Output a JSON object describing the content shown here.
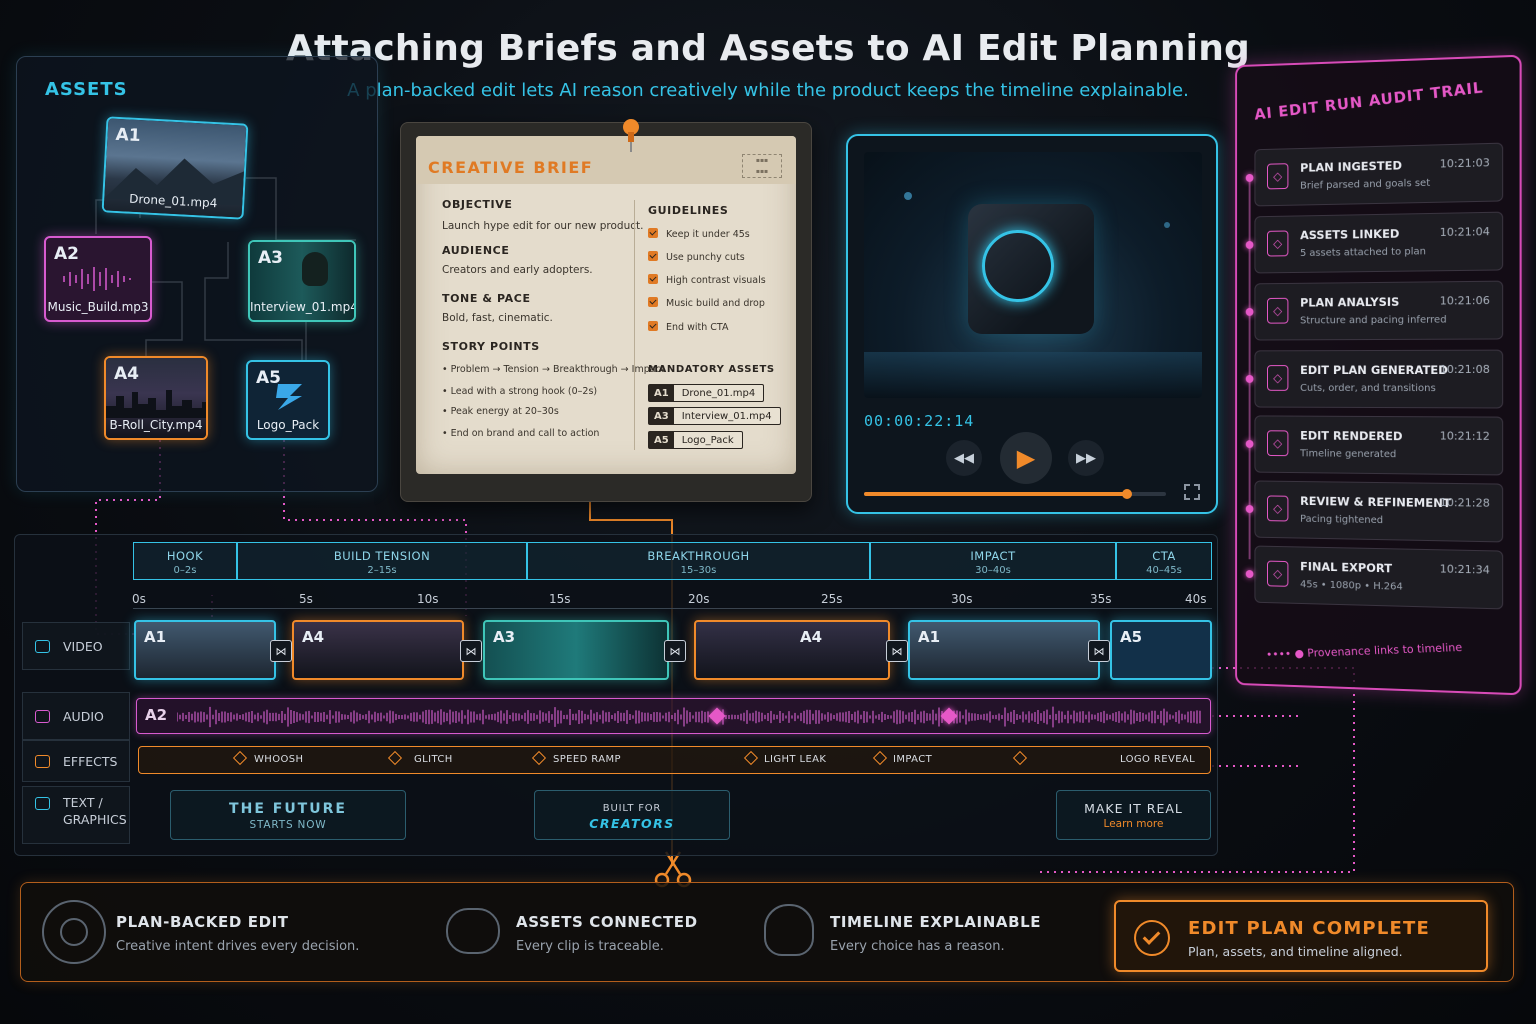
{
  "header": {
    "title": "Attaching Briefs and Assets to AI Edit Planning",
    "subtitle": "A plan-backed edit lets AI reason creatively while the product keeps the timeline explainable."
  },
  "assets": {
    "title": "ASSETS",
    "items": [
      {
        "tag": "A1",
        "name": "Drone_01.mp4"
      },
      {
        "tag": "A2",
        "name": "Music_Build.mp3"
      },
      {
        "tag": "A3",
        "name": "Interview_01.mp4"
      },
      {
        "tag": "A4",
        "name": "B-Roll_City.mp4"
      },
      {
        "tag": "A5",
        "name": "Logo_Pack"
      }
    ]
  },
  "brief": {
    "title": "CREATIVE BRIEF",
    "objective_label": "OBJECTIVE",
    "objective": "Launch hype edit for our new product.",
    "audience_label": "AUDIENCE",
    "audience": "Creators and early adopters.",
    "tone_label": "TONE & PACE",
    "tone": "Bold, fast, cinematic.",
    "story_label": "STORY POINTS",
    "story_points": [
      "Problem → Tension → Breakthrough → Impact",
      "Lead with a strong hook (0–2s)",
      "Peak energy at 20–30s",
      "End on brand and call to action"
    ],
    "guidelines_label": "GUIDELINES",
    "guidelines": [
      "Keep it under 45s",
      "Use punchy cuts",
      "High contrast visuals",
      "Music build and drop",
      "End with CTA"
    ],
    "mandatory_label": "MANDATORY ASSETS",
    "mandatory": [
      {
        "tag": "A1",
        "name": "Drone_01.mp4"
      },
      {
        "tag": "A3",
        "name": "Interview_01.mp4"
      },
      {
        "tag": "A5",
        "name": "Logo_Pack"
      }
    ]
  },
  "player": {
    "timecode": "00:00:22:14",
    "progress": 0.87,
    "icons": [
      "rewind-icon",
      "play-icon",
      "fast-forward-icon",
      "fullscreen-icon"
    ]
  },
  "audit": {
    "title": "AI EDIT RUN AUDIT TRAIL",
    "items": [
      {
        "name": "PLAN INGESTED",
        "desc": "Brief parsed and goals set",
        "time": "10:21:03"
      },
      {
        "name": "ASSETS LINKED",
        "desc": "5 assets attached to plan",
        "time": "10:21:04"
      },
      {
        "name": "PLAN ANALYSIS",
        "desc": "Structure and pacing inferred",
        "time": "10:21:06"
      },
      {
        "name": "EDIT PLAN GENERATED",
        "desc": "Cuts, order, and transitions",
        "time": "10:21:08"
      },
      {
        "name": "EDIT RENDERED",
        "desc": "Timeline generated",
        "time": "10:21:12"
      },
      {
        "name": "REVIEW & REFINEMENT",
        "desc": "Pacing tightened",
        "time": "10:21:28"
      },
      {
        "name": "FINAL EXPORT",
        "desc": "45s • 1080p • H.264",
        "time": "10:21:34"
      }
    ],
    "footer": "Provenance links to timeline"
  },
  "timeline": {
    "segments": [
      {
        "label": "HOOK",
        "range": "0–2s"
      },
      {
        "label": "BUILD TENSION",
        "range": "2–15s"
      },
      {
        "label": "BREAKTHROUGH",
        "range": "15–30s"
      },
      {
        "label": "IMPACT",
        "range": "30–40s"
      },
      {
        "label": "CTA",
        "range": "40–45s"
      }
    ],
    "ticks": [
      "0s",
      "5s",
      "10s",
      "15s",
      "20s",
      "25s",
      "30s",
      "35s",
      "40s"
    ],
    "tracks": [
      "VIDEO",
      "AUDIO",
      "EFFECTS",
      "TEXT /",
      "GRAPHICS"
    ],
    "video_clips": [
      "A1",
      "A4",
      "A3",
      "A4",
      "A1",
      "A5"
    ],
    "audio_clip": "A2",
    "effects": [
      "WHOOSH",
      "GLITCH",
      "SPEED RAMP",
      "LIGHT LEAK",
      "IMPACT",
      "LOGO REVEAL"
    ],
    "graphics": [
      {
        "line1": "THE FUTURE",
        "line2": "STARTS NOW"
      },
      {
        "line1": "BUILT FOR",
        "line2": "CREATORS"
      },
      {
        "line1": "MAKE IT REAL",
        "line2": "Learn more"
      }
    ]
  },
  "summary": {
    "items": [
      {
        "name": "PLAN-BACKED EDIT",
        "desc": "Creative intent drives every decision."
      },
      {
        "name": "ASSETS CONNECTED",
        "desc": "Every clip is traceable."
      },
      {
        "name": "TIMELINE EXPLAINABLE",
        "desc": "Every choice has a reason."
      }
    ],
    "status_title": "EDIT PLAN COMPLETE",
    "status_desc": "Plan, assets, and timeline aligned."
  },
  "colors": {
    "cyan": "#35c3e6",
    "pink": "#d85bd0",
    "orange": "#f08a2a",
    "teal": "#3fc6b9"
  }
}
